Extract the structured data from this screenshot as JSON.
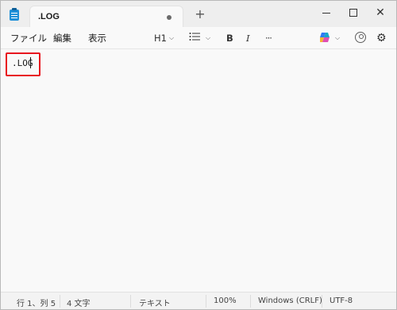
{
  "window": {
    "tab_title": ".LOG",
    "new_tab_symbol": "+",
    "close_symbol": "✕"
  },
  "menu": {
    "file": "ファイル",
    "edit": "編集",
    "view": "表示"
  },
  "toolbar": {
    "heading": "H1",
    "heading_icon": "chevron-down-icon",
    "list_icon": "list-icon",
    "bold": "B",
    "italic": "I",
    "more": "···",
    "copilot_icon": "copilot-icon",
    "account_icon": "account-icon",
    "settings_icon": "gear-icon"
  },
  "editor": {
    "content": ".LOG",
    "highlight_color": "#e8161f"
  },
  "statusbar": {
    "position": "行 1、列 5",
    "char_count": "4 文字",
    "file_type": "テキスト",
    "zoom": "100%",
    "line_ending": "Windows (CRLF)",
    "encoding": "UTF-8"
  }
}
